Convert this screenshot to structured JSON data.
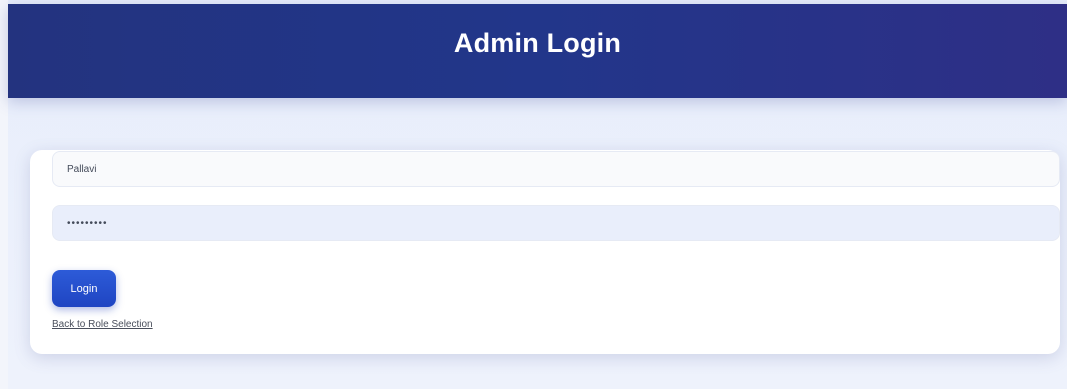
{
  "header": {
    "title": "Admin Login"
  },
  "form": {
    "username_value": "Pallavi",
    "password_value": "•••••••••",
    "login_label": "Login",
    "back_link_label": "Back to Role Selection"
  },
  "colors": {
    "header_bg": "#23337f",
    "button_bg": "#2450cc",
    "page_bg": "#eaeffb"
  }
}
